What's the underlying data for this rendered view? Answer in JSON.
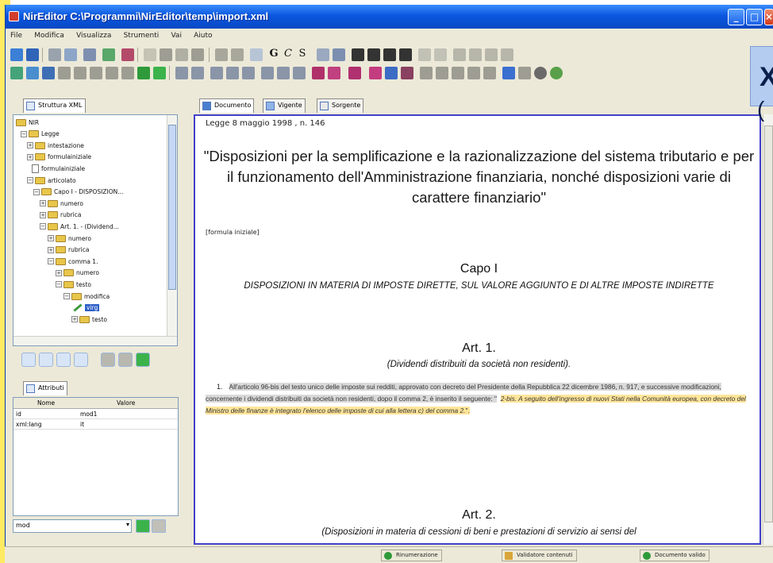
{
  "window": {
    "title": "NirEditor   C:\\Programmi\\NirEditor\\temp\\import.xml"
  },
  "window_buttons": {
    "minimize": "_",
    "maximize": "□",
    "close": "×"
  },
  "menu": [
    "File",
    "Modifica",
    "Visualizza",
    "Strumenti",
    "Vai",
    "Aiuto"
  ],
  "toolbar": {
    "format_letters": [
      "G",
      "C",
      "S"
    ]
  },
  "overlay": {
    "big_letter": "X",
    "paren": "("
  },
  "left_tab": {
    "label": "Struttura XML"
  },
  "tree": [
    {
      "label": "NIR",
      "icon": "folder",
      "exp": ""
    },
    {
      "label": "Legge",
      "icon": "folder",
      "exp": "−"
    },
    {
      "label": "intestazione",
      "icon": "folder",
      "exp": "+"
    },
    {
      "label": "formulainiziale",
      "icon": "folder",
      "exp": "+"
    },
    {
      "label": "formulainiziale",
      "icon": "doc",
      "exp": ""
    },
    {
      "label": "articolato",
      "icon": "folder",
      "exp": "−"
    },
    {
      "label": "Capo I - DISPOSIZION...",
      "icon": "folder",
      "exp": "−"
    },
    {
      "label": "numero",
      "icon": "folder",
      "exp": "+"
    },
    {
      "label": "rubrica",
      "icon": "folder",
      "exp": "+"
    },
    {
      "label": "Art. 1. - (Dividend...",
      "icon": "folder",
      "exp": "−"
    },
    {
      "label": "numero",
      "icon": "folder",
      "exp": "+"
    },
    {
      "label": "rubrica",
      "icon": "folder",
      "exp": "+"
    },
    {
      "label": "comma 1.",
      "icon": "folder",
      "exp": "−"
    },
    {
      "label": "numero",
      "icon": "folder",
      "exp": "+"
    },
    {
      "label": "testo",
      "icon": "folder",
      "exp": "−"
    },
    {
      "label": "modifica",
      "icon": "folder",
      "exp": "−"
    },
    {
      "label": "virg",
      "icon": "pencil",
      "exp": ""
    },
    {
      "label": "testo",
      "icon": "folder",
      "exp": "+"
    }
  ],
  "attr_tab": {
    "label": "Attributi"
  },
  "attributes": {
    "headers": [
      "Nome",
      "Valore"
    ],
    "rows": [
      {
        "name": "id",
        "value": "mod1"
      },
      {
        "name": "xml:lang",
        "value": "it"
      }
    ]
  },
  "lang_select": {
    "value": "mod"
  },
  "doc_tabs": [
    "Documento",
    "Vigente",
    "Sorgente"
  ],
  "doc": {
    "header": "Legge     8 maggio 1998 , n.     146",
    "title": "\"Disposizioni per la semplificazione e la razionalizzazione del sistema tributario e per il funzionamento dell'Amministrazione finanziaria, nonché disposizioni varie di carattere finanziario\"",
    "formula": "[formula iniziale]",
    "capo": "Capo I",
    "capo_rubrica": "DISPOSIZIONI IN MATERIA DI IMPOSTE DIRETTE, SUL VALORE AGGIUNTO E DI ALTRE IMPOSTE INDIRETTE",
    "art1": "Art. 1.",
    "art1_rubrica": "(Dividendi distribuiti da società non residenti).",
    "comma_num": "1.",
    "comma_text": "All'articolo 96-bis del testo unico delle imposte sui redditi, approvato con decreto del Presidente della Repubblica 22 dicembre 1986, n. 917, e successive modificazioni, concernente i dividendi distribuiti da società non residenti, dopo il comma 2, è inserito il seguente: \"",
    "comma_quote": "2-bis. A seguito dell'ingresso di nuovi Stati nella Comunità europea, con decreto del Ministro delle finanze è integrato l'elenco delle imposte di cui alla lettera c) del comma 2.",
    "comma_end": "\".",
    "art2": "Art. 2.",
    "art2_rubrica": "(Disposizioni in materia di cessioni di beni e prestazioni di servizio ai sensi del"
  },
  "status": [
    "Rinumerazione",
    "Validatore contenuti",
    "Documento valido"
  ],
  "colors": {
    "titlebar": "#0a57e0",
    "editor_border": "#4141c8",
    "quote_highlight": "#ffe59a",
    "comma_highlight": "#d9d9d9"
  }
}
